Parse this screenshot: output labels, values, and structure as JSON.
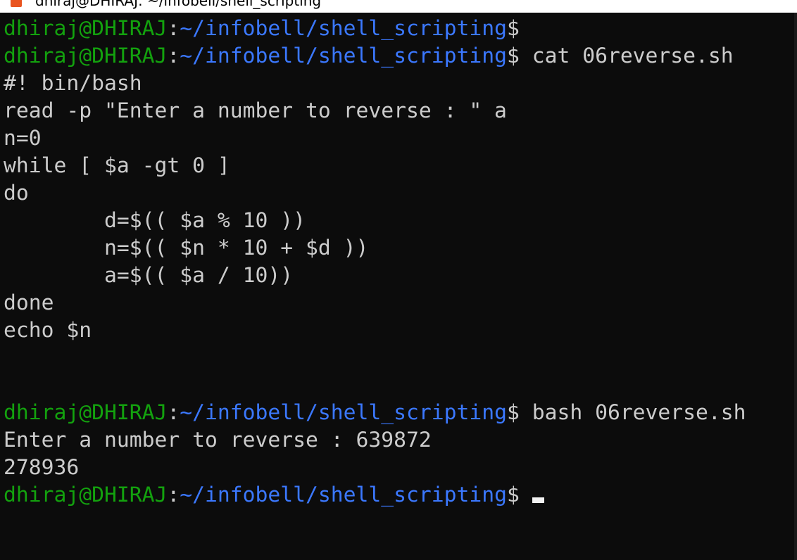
{
  "window": {
    "title": "dhiraj@DHIRAJ: ~/infobell/shell_scripting",
    "icon": "ubuntu-icon"
  },
  "colors": {
    "background": "#0c0c0c",
    "user_host": "#13a10e",
    "path": "#3b78ff",
    "text": "#cccccc"
  },
  "terminal": {
    "lines": [
      [
        {
          "t": "dhiraj@DHIRAJ",
          "c": "g"
        },
        {
          "t": ":",
          "c": "w"
        },
        {
          "t": "~/infobell/shell_scripting",
          "c": "b"
        },
        {
          "t": "$",
          "c": "w"
        }
      ],
      [
        {
          "t": "dhiraj@DHIRAJ",
          "c": "g"
        },
        {
          "t": ":",
          "c": "w"
        },
        {
          "t": "~/infobell/shell_scripting",
          "c": "b"
        },
        {
          "t": "$ cat 06reverse.sh",
          "c": "w"
        }
      ],
      [
        {
          "t": "#! bin/bash",
          "c": "w"
        }
      ],
      [
        {
          "t": "read -p \"Enter a number to reverse : \" a",
          "c": "w"
        }
      ],
      [
        {
          "t": "n=0",
          "c": "w"
        }
      ],
      [
        {
          "t": "while [ $a -gt 0 ]",
          "c": "w"
        }
      ],
      [
        {
          "t": "do",
          "c": "w"
        }
      ],
      [
        {
          "t": "        d=$(( $a % 10 ))",
          "c": "w"
        }
      ],
      [
        {
          "t": "        n=$(( $n * 10 + $d ))",
          "c": "w"
        }
      ],
      [
        {
          "t": "        a=$(( $a / 10))",
          "c": "w"
        }
      ],
      [
        {
          "t": "done",
          "c": "w"
        }
      ],
      [
        {
          "t": "echo $n",
          "c": "w"
        }
      ],
      [],
      [],
      [
        {
          "t": "dhiraj@DHIRAJ",
          "c": "g"
        },
        {
          "t": ":",
          "c": "w"
        },
        {
          "t": "~/infobell/shell_scripting",
          "c": "b"
        },
        {
          "t": "$ bash 06reverse.sh",
          "c": "w"
        }
      ],
      [
        {
          "t": "Enter a number to reverse : 639872",
          "c": "w"
        }
      ],
      [
        {
          "t": "278936",
          "c": "w"
        }
      ],
      [
        {
          "t": "dhiraj@DHIRAJ",
          "c": "g"
        },
        {
          "t": ":",
          "c": "w"
        },
        {
          "t": "~/infobell/shell_scripting",
          "c": "b"
        },
        {
          "t": "$",
          "c": "w"
        }
      ]
    ]
  }
}
